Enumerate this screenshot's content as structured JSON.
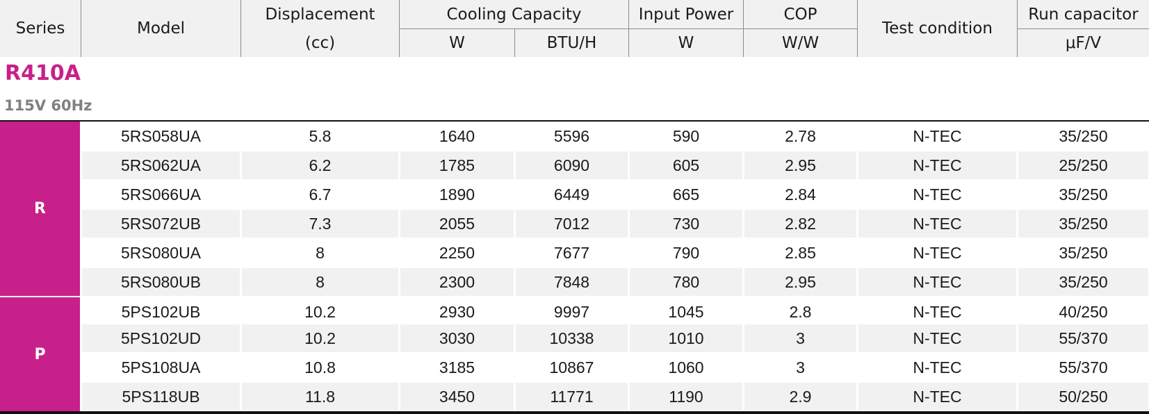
{
  "header": {
    "series": "Series",
    "model": "Model",
    "displacement": "Displacement",
    "displacement_unit": "(cc)",
    "cooling_capacity": "Cooling Capacity",
    "cooling_w_unit": "W",
    "cooling_btu_unit": "BTU/H",
    "input_power": "Input Power",
    "input_power_unit": "W",
    "cop": "COP",
    "cop_unit": "W/W",
    "test_condition": "Test condition",
    "run_capacitor": "Run capacitor",
    "run_capacitor_unit": "μF/V"
  },
  "section": {
    "refrigerant": "R410A",
    "voltage": "115V 60Hz"
  },
  "colors": {
    "accent": "#c8208a",
    "header_bg": "#f1f1f1",
    "voltage_text": "#808080"
  },
  "groups": [
    {
      "series": "R",
      "row_count": 6
    },
    {
      "series": "P",
      "row_count": 4
    }
  ],
  "rows": [
    {
      "model": "5RS058UA",
      "displacement": "5.8",
      "cooling_w": "1640",
      "cooling_btu": "5596",
      "input_w": "590",
      "cop": "2.78",
      "test": "N-TEC",
      "capacitor": "35/250"
    },
    {
      "model": "5RS062UA",
      "displacement": "6.2",
      "cooling_w": "1785",
      "cooling_btu": "6090",
      "input_w": "605",
      "cop": "2.95",
      "test": "N-TEC",
      "capacitor": "25/250"
    },
    {
      "model": "5RS066UA",
      "displacement": "6.7",
      "cooling_w": "1890",
      "cooling_btu": "6449",
      "input_w": "665",
      "cop": "2.84",
      "test": "N-TEC",
      "capacitor": "35/250"
    },
    {
      "model": "5RS072UB",
      "displacement": "7.3",
      "cooling_w": "2055",
      "cooling_btu": "7012",
      "input_w": "730",
      "cop": "2.82",
      "test": "N-TEC",
      "capacitor": "35/250"
    },
    {
      "model": "5RS080UA",
      "displacement": "8",
      "cooling_w": "2250",
      "cooling_btu": "7677",
      "input_w": "790",
      "cop": "2.85",
      "test": "N-TEC",
      "capacitor": "35/250"
    },
    {
      "model": "5RS080UB",
      "displacement": "8",
      "cooling_w": "2300",
      "cooling_btu": "7848",
      "input_w": "780",
      "cop": "2.95",
      "test": "N-TEC",
      "capacitor": "35/250"
    },
    {
      "model": "5PS102UB",
      "displacement": "10.2",
      "cooling_w": "2930",
      "cooling_btu": "9997",
      "input_w": "1045",
      "cop": "2.8",
      "test": "N-TEC",
      "capacitor": "40/250"
    },
    {
      "model": "5PS102UD",
      "displacement": "10.2",
      "cooling_w": "3030",
      "cooling_btu": "10338",
      "input_w": "1010",
      "cop": "3",
      "test": "N-TEC",
      "capacitor": "55/370"
    },
    {
      "model": "5PS108UA",
      "displacement": "10.8",
      "cooling_w": "3185",
      "cooling_btu": "10867",
      "input_w": "1060",
      "cop": "3",
      "test": "N-TEC",
      "capacitor": "55/370"
    },
    {
      "model": "5PS118UB",
      "displacement": "11.8",
      "cooling_w": "3450",
      "cooling_btu": "11771",
      "input_w": "1190",
      "cop": "2.9",
      "test": "N-TEC",
      "capacitor": "50/250"
    }
  ]
}
